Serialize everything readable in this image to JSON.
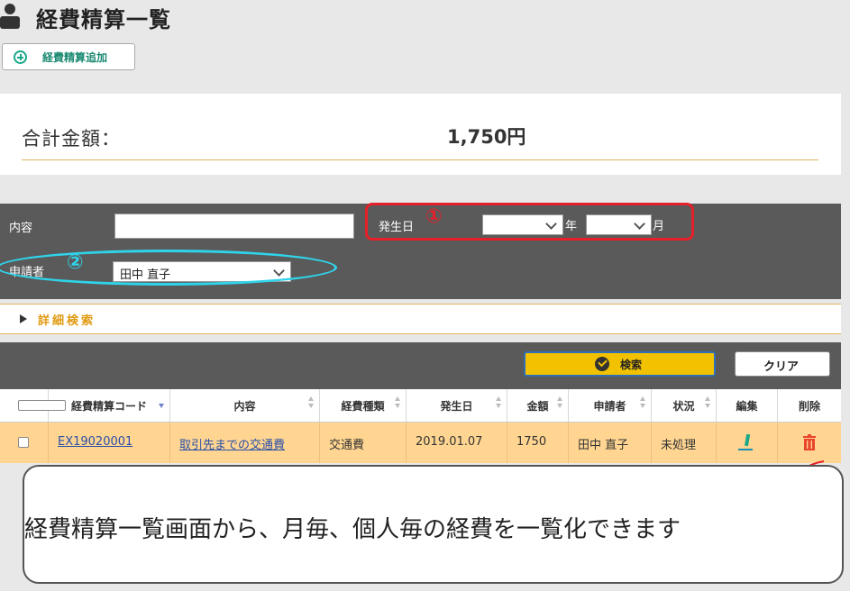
{
  "header": {
    "title": "経費精算一覧",
    "add_button_label": "経費精算追加"
  },
  "summary": {
    "total_label": "合計金額：",
    "total_value": "1,750円"
  },
  "search": {
    "content_label": "内容",
    "content_value": "",
    "date_label": "発生日",
    "year_value": "",
    "year_unit": "年",
    "month_value": "",
    "month_unit": "月",
    "applicant_label": "申請者",
    "applicant_value": "田中 直子",
    "detail_label": "詳細検索",
    "search_button": "検索",
    "clear_button": "クリア"
  },
  "annotations": {
    "marker_1": "①",
    "marker_2": "②",
    "callout": "経費精算一覧画面から、月毎、個人毎の経費を一覧化できます",
    "colors": {
      "red": "#e5202a",
      "cyan": "#2fd4ea"
    }
  },
  "table": {
    "columns": [
      "経費精算コード",
      "内容",
      "経費種類",
      "発生日",
      "金額",
      "申請者",
      "状況",
      "編集",
      "削除"
    ],
    "rows": [
      {
        "code": "EX19020001",
        "content": "取引先までの交通費",
        "type": "交通費",
        "date": "2019.01.07",
        "amount": "1750",
        "applicant": "田中 直子",
        "status": "未処理",
        "edit_icon": "edit-pencil-icon",
        "delete_icon": "trash-icon"
      }
    ]
  },
  "colors": {
    "accent_green": "#1aa88a",
    "search_button": "#f2c200",
    "panel_dark": "#5a5a5a",
    "row_highlight": "#ffd591",
    "link": "#2a4fa8"
  }
}
